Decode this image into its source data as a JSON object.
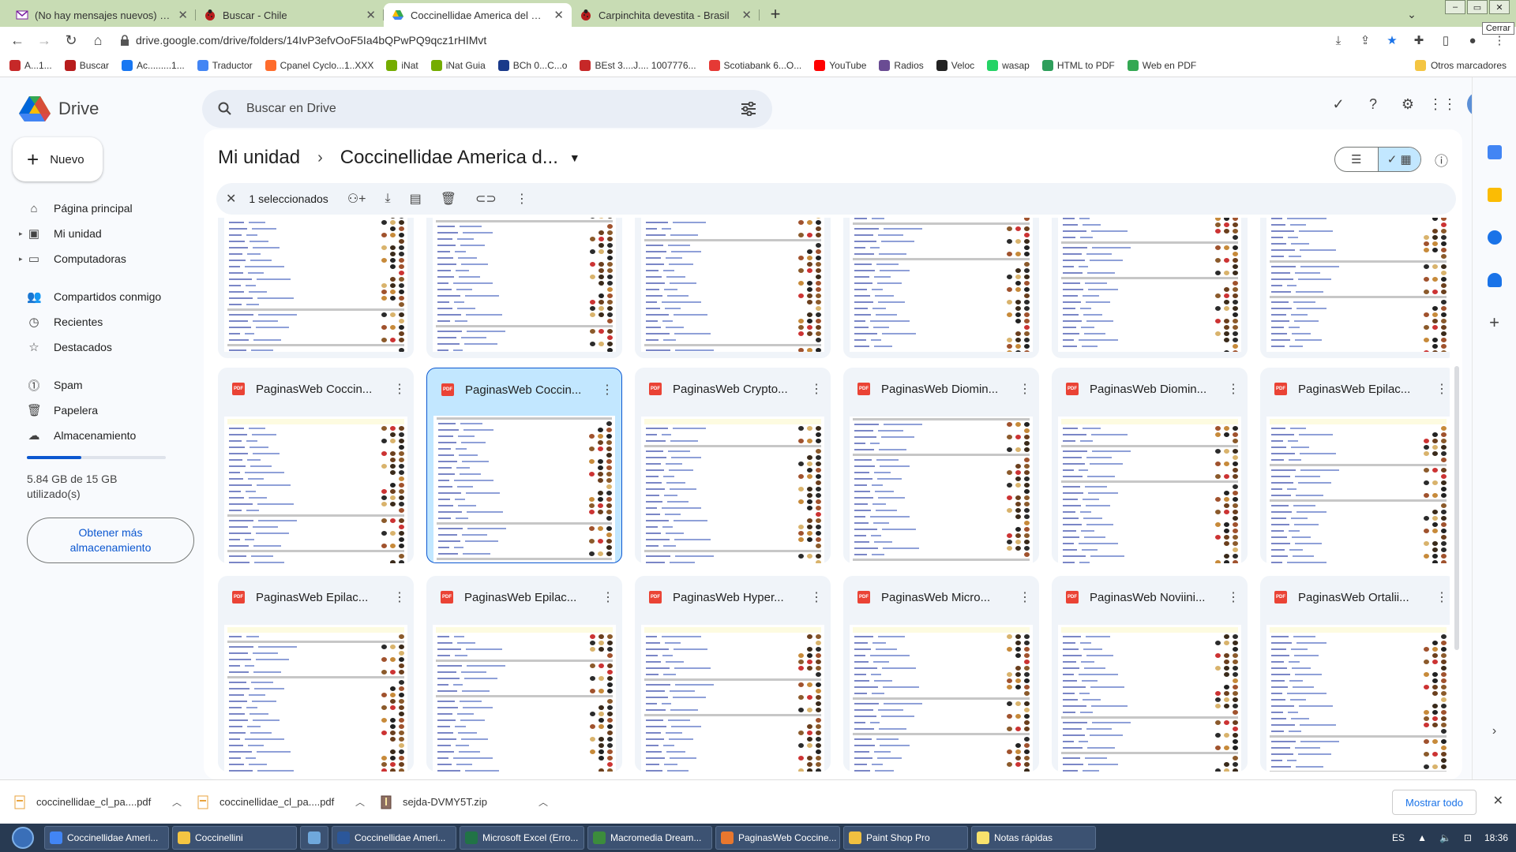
{
  "browser": {
    "tabs": [
      {
        "title": "(No hay mensajes nuevos) - willo",
        "icon": "gmail-icon",
        "color": "#7b1fa2"
      },
      {
        "title": "Buscar - Chile",
        "icon": "ladybug-icon",
        "color": "#b71c1c"
      },
      {
        "title": "Coccinellidae America del Sur en",
        "icon": "drive-icon",
        "color": "#1a73e8",
        "active": true
      },
      {
        "title": "Carpinchita devestita - Brasil",
        "icon": "ladybug-icon",
        "color": "#b71c1c"
      }
    ],
    "tooltip": "Cerrar",
    "url": "drive.google.com/drive/folders/14IvP3efvOoF5Ia4bQPwPQ9qcz1rHIMvt",
    "bookmarks": [
      {
        "label": "A...1...",
        "color": "#c62828"
      },
      {
        "label": "Buscar",
        "color": "#b71c1c"
      },
      {
        "label": "Ac.........1...",
        "color": "#1877f2"
      },
      {
        "label": "Traductor",
        "color": "#4285f4"
      },
      {
        "label": "Cpanel Cyclo...1..XXX",
        "color": "#ff6c2c"
      },
      {
        "label": "iNat",
        "color": "#74ac00"
      },
      {
        "label": "iNat Guia",
        "color": "#74ac00"
      },
      {
        "label": "BCh 0...C...o",
        "color": "#1a3a8a"
      },
      {
        "label": "BEst 3....J.... 1007776...",
        "color": "#c62828"
      },
      {
        "label": "Scotiabank 6...O...",
        "color": "#e53935"
      },
      {
        "label": "YouTube",
        "color": "#ff0000"
      },
      {
        "label": "Radios",
        "color": "#6a4c93"
      },
      {
        "label": "Veloc",
        "color": "#222222"
      },
      {
        "label": "wasap",
        "color": "#25d366"
      },
      {
        "label": "HTML to PDF",
        "color": "#2e9e5b"
      },
      {
        "label": "Web en PDF",
        "color": "#34a853"
      }
    ],
    "other_bookmarks": "Otros marcadores"
  },
  "drive": {
    "app_name": "Drive",
    "search_placeholder": "Buscar en Drive",
    "new_button": "Nuevo",
    "sidebar": [
      {
        "label": "Página principal",
        "icon": "home-icon"
      },
      {
        "label": "Mi unidad",
        "icon": "drive-icon"
      },
      {
        "label": "Computadoras",
        "icon": "computer-icon"
      },
      {
        "label": "Compartidos conmigo",
        "icon": "people-icon"
      },
      {
        "label": "Recientes",
        "icon": "clock-icon"
      },
      {
        "label": "Destacados",
        "icon": "star-icon"
      },
      {
        "label": "Spam",
        "icon": "spam-icon"
      },
      {
        "label": "Papelera",
        "icon": "trash-icon"
      },
      {
        "label": "Almacenamiento",
        "icon": "cloud-icon"
      }
    ],
    "storage_text": "5.84 GB de 15 GB utilizado(s)",
    "storage_fraction": 0.39,
    "get_more": "Obtener más almacenamiento",
    "breadcrumb": {
      "root": "Mi unidad",
      "current": "Coccinellidae America d..."
    },
    "selection": "1 seleccionados",
    "files_row2": [
      "PaginasWeb Coccin...",
      "PaginasWeb Coccin...",
      "PaginasWeb Crypto...",
      "PaginasWeb Diomin...",
      "PaginasWeb Diomin...",
      "PaginasWeb Epilac..."
    ],
    "files_row3": [
      "PaginasWeb Epilac...",
      "PaginasWeb Epilac...",
      "PaginasWeb Hyper...",
      "PaginasWeb Micro...",
      "PaginasWeb Noviini...",
      "PaginasWeb Ortalii..."
    ],
    "selected_index_row2": 1
  },
  "downloads": {
    "items": [
      "coccinellidae_cl_pa....pdf",
      "coccinellidae_cl_pa....pdf",
      "sejda-DVMY5T.zip"
    ],
    "show_all": "Mostrar todo"
  },
  "taskbar": {
    "items": [
      {
        "label": "Coccinellidae Ameri...",
        "color": "#4285f4"
      },
      {
        "label": "Coccinellini",
        "color": "#f4c542"
      },
      {
        "label": "",
        "color": "#6fa8dc"
      },
      {
        "label": "Coccinellidae Ameri...",
        "color": "#2b579a"
      },
      {
        "label": "Microsoft Excel (Erro...",
        "color": "#217346"
      },
      {
        "label": "Macromedia Dream...",
        "color": "#3c8c3c"
      },
      {
        "label": "PaginasWeb Coccine...",
        "color": "#e8772e"
      },
      {
        "label": "Paint Shop Pro",
        "color": "#f0c040"
      },
      {
        "label": "Notas rápidas",
        "color": "#f8e26c"
      }
    ],
    "lang": "ES",
    "time": "18:36"
  }
}
